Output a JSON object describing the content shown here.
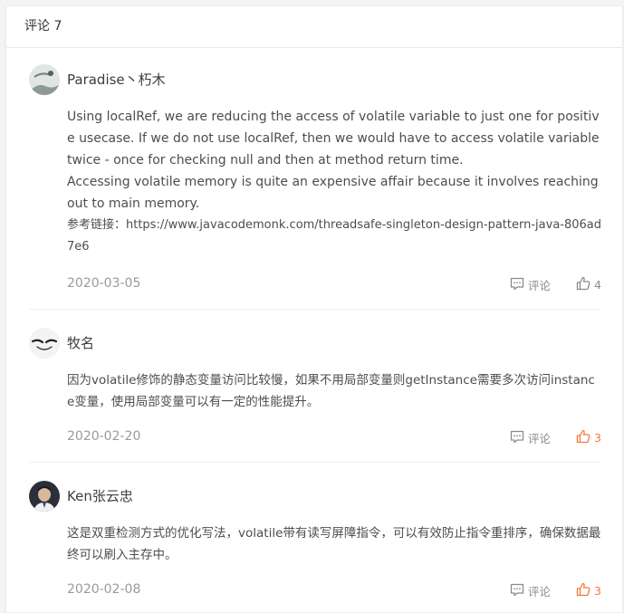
{
  "header": {
    "title": "评论 7"
  },
  "comments": [
    {
      "user": "Paradise丶朽木",
      "content": [
        "Using localRef, we are reducing the access of volatile variable to just one for positive usecase. If we do not use localRef, then we would have to access volatile variable twice - once for checking null and then at method return time.",
        "Accessing volatile memory is quite an expensive affair because it involves reaching out to main memory."
      ],
      "reference": "参考链接：https://www.javacodemonk.com/threadsafe-singleton-design-pattern-java-806ad7e6",
      "date": "2020-03-05",
      "reply_label": "评论",
      "likes": "4",
      "liked": false
    },
    {
      "user": "牧名",
      "content": [
        "因为volatile修饰的静态变量访问比较慢，如果不用局部变量则getInstance需要多次访问instance变量，使用局部变量可以有一定的性能提升。"
      ],
      "date": "2020-02-20",
      "reply_label": "评论",
      "likes": "3",
      "liked": true
    },
    {
      "user": "Ken张云忠",
      "content": [
        "这是双重检测方式的优化写法，volatile带有读写屏障指令，可以有效防止指令重排序，确保数据最终可以刷入主存中。"
      ],
      "date": "2020-02-08",
      "reply_label": "评论",
      "likes": "3",
      "liked": true
    }
  ],
  "colors": {
    "liked": "#f5793b",
    "muted": "#8a8a8a",
    "text": "#4d4d4d"
  },
  "icons": {
    "reply": "comment-bubble-icon",
    "like": "thumbs-up-icon"
  }
}
